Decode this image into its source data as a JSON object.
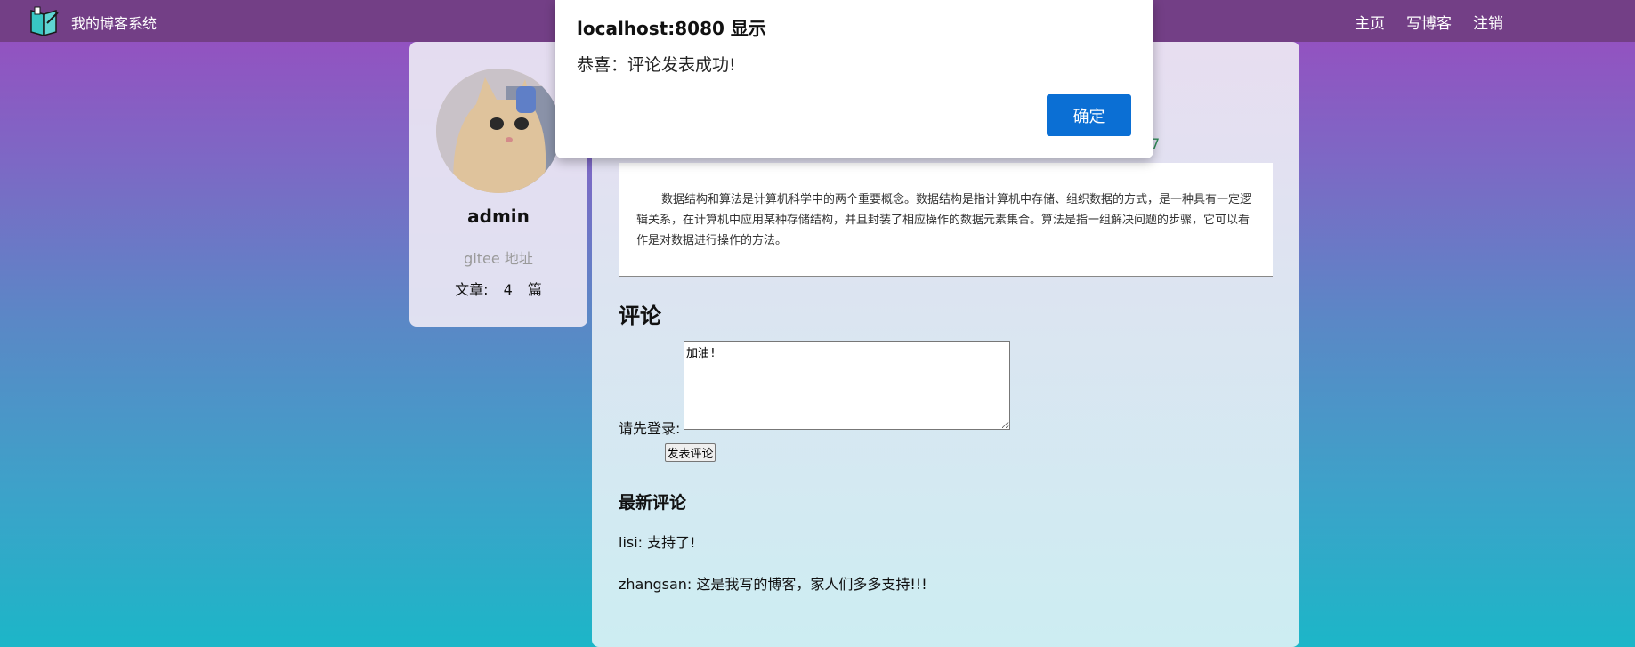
{
  "navbar": {
    "title": "我的博客系统",
    "links": [
      "主页",
      "写博客",
      "注销"
    ]
  },
  "profile": {
    "username": "admin",
    "gitee": "gitee 地址",
    "stats": {
      "label": "文章:",
      "count": "4",
      "unit": "篇"
    }
  },
  "article": {
    "date_suffix": "7",
    "content": "数据结构和算法是计算机科学中的两个重要概念。数据结构是指计算机中存储、组织数据的方式，是一种具有一定逻辑关系，在计算机中应用某种存储结构，并且封装了相应操作的数据元素集合。算法是指一组解决问题的步骤，它可以看作是对数据进行操作的方法。"
  },
  "comments": {
    "title": "评论",
    "login_label": "请先登录:",
    "input_value": "加油!",
    "submit_label": "发表评论",
    "latest_title": "最新评论",
    "items": [
      "lisi: 支持了!",
      "zhangsan: 这是我写的博客，家人们多多支持!!!"
    ]
  },
  "dialog": {
    "title": "localhost:8080 显示",
    "message": "恭喜：评论发表成功!",
    "ok_label": "确定"
  },
  "colors": {
    "navbar": "#733f86",
    "dialog_button": "#0b6fd4",
    "date": "#2e8b57"
  }
}
